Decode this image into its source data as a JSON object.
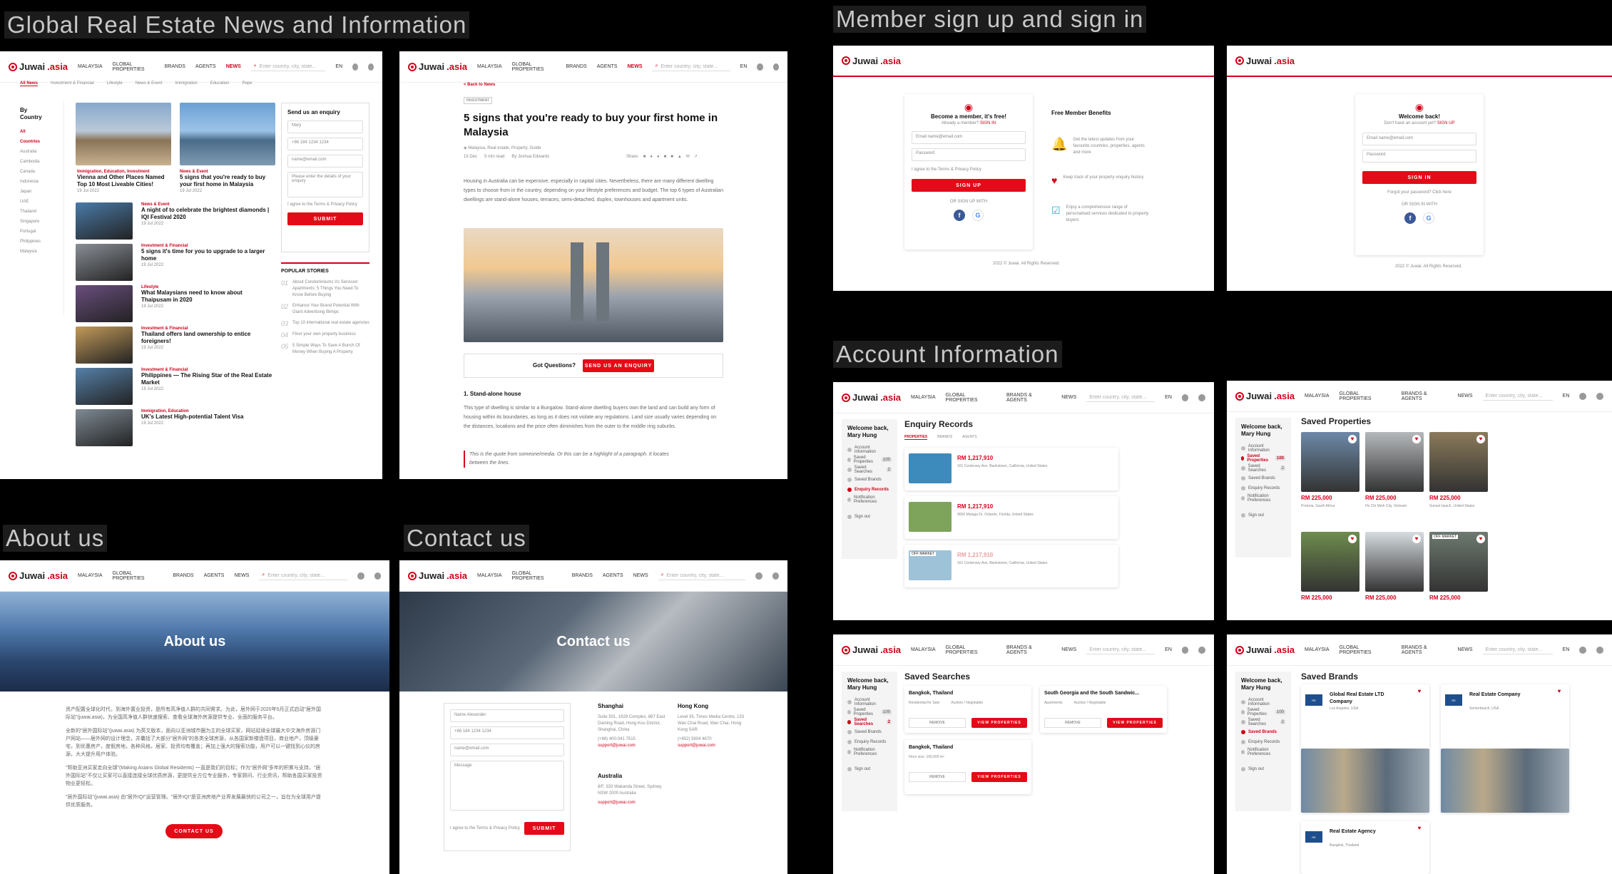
{
  "sections": {
    "news": "Global Real Estate News and Information",
    "member": "Member sign up and sign in",
    "account": "Account Information",
    "about": "About us",
    "contact": "Contact us"
  },
  "colors": {
    "brand": "#e30b17",
    "bg": "#000000"
  },
  "nav": {
    "logo": "Juwai",
    "logo_suffix": ".asia",
    "country": "MALAYSIA",
    "global": "GLOBAL PROPERTIES",
    "brands": "BRANDS",
    "agents": "AGENTS",
    "news": "NEWS",
    "brands_agents": "BRANDS & AGENTS",
    "search_placeholder": "Enter country, city, state...",
    "lang": "EN"
  },
  "news_page": {
    "tabs": [
      "All News",
      "Investment & Financial",
      "Lifestyle",
      "News & Event",
      "Immigration",
      "Education",
      "Pepe"
    ],
    "by_country": "By Country",
    "countries": [
      "All Countries",
      "Australia",
      "Cambodia",
      "Canada",
      "Indonesia",
      "Japan",
      "UAE",
      "Thailand",
      "Singapore",
      "Portugal",
      "Philippines",
      "Malaysia"
    ],
    "featured": [
      {
        "cat": "Immigration, Education, Investment",
        "title": "Vienna and Other Places Named Top 10 Most Liveable Cities!",
        "date": "19 Jul 2022"
      },
      {
        "cat": "News & Event",
        "title": "5 signs that you're ready to buy your first home in Malaysia",
        "date": "19 Jul 2022"
      }
    ],
    "list": [
      {
        "cat": "News & Event",
        "title": "A night of to celebrate the brightest diamonds | IQI Festival 2020",
        "date": "19 Jul 2022"
      },
      {
        "cat": "Investment & Financial",
        "title": "5 signs it's time for you to upgrade to a larger home",
        "date": "19 Jul 2022"
      },
      {
        "cat": "Lifestyle",
        "title": "What Malaysians need to know about Thaipusam in 2020",
        "date": "19 Jul 2022"
      },
      {
        "cat": "Investment & Financial",
        "title": "Thailand offers land ownership to entice foreigners!",
        "date": "19 Jul 2022"
      },
      {
        "cat": "Investment & Financial",
        "title": "Philippines — The Rising Star of the Real Estate Market",
        "date": "19 Jul 2022"
      },
      {
        "cat": "Immigration, Education",
        "title": "UK's Latest High-potential Talent Visa",
        "date": "19 Jul 2022"
      }
    ],
    "enquiry_title": "Send us an enquiry",
    "enquiry_name": "Mary",
    "enquiry_phone": "+86 184 1234 1234",
    "enquiry_email": "name@email.com",
    "enquiry_msg": "Please enter the details of your enquiry",
    "agree": "I agree to the Terms & Privacy Policy",
    "submit": "SUBMIT",
    "popular": "POPULAR STORIES",
    "stories": [
      {
        "n": "01",
        "t": "About Condominiums Vs Serviced Apartments: 5 Things You Need To Know Before Buying"
      },
      {
        "n": "02",
        "t": "Enhance Your Brand Potential With Giant Advertising Blimps"
      },
      {
        "n": "03",
        "t": "Top 10 international real estate agencies"
      },
      {
        "n": "04",
        "t": "Floor your own property business"
      },
      {
        "n": "05",
        "t": "5 Simple Ways To Save A Bunch Of Money When Buying A Property"
      }
    ]
  },
  "article": {
    "back": "< Back to News",
    "tag": "INVESTMENT",
    "title": "5 signs that you're ready to buy your first home in Malaysia",
    "meta": "Malaysia, Real estate, Property, Guide",
    "date": "15 Dec",
    "read": "5 min read",
    "author": "By Joshua Edwards",
    "share": "Share:",
    "body": "Housing in Australia can be expensive, especially in capital cities. Nevertheless, there are many different dwelling types to choose from in the country, depending on your lifestyle preferences and budget. The top 6 types of Australian dwellings are stand-alone houses, terraces, semi-detached, duplex, townhouses and apartment units.",
    "question": "Got Questions?",
    "enquiry_btn": "SEND US AN ENQUIRY",
    "h2": "1. Stand-alone house",
    "body2": "This type of dwelling is similar to a Bungalow. Stand-alone dwelling buyers own the land and can build any form of housing within its boundaries, as long as it does not violate any regulations. Land size usually varies depending on the distances, locations and the price often diminishes from the outer to the middle ring suburbs.",
    "quote": "This is the quote from someone/media. Or this can be a highlight of a paragraph.  It locates between the lines."
  },
  "signup": {
    "title": "Become a member, it's free!",
    "already": "Already a member?",
    "signin_link": "SIGN IN",
    "email_label": "Email",
    "email": "name@email.com",
    "password": "Password",
    "agree": "I agree to the Terms & Privacy Policy",
    "btn": "SIGN UP",
    "or": "OR SIGN UP WITH",
    "benefits_title": "Free Member Benefits",
    "benefits": [
      "Get the latest updates from your favourite countries, properties, agents and more",
      "Keep track of your property enquiry history",
      "Enjoy a comprehensive range of personalised services dedicated to property buyers"
    ],
    "copyright": "2022 © Juwai. All Rights Reserved."
  },
  "signin": {
    "title": "Welcome back!",
    "no_account": "Don't have an account yet?",
    "signup_link": "SIGN UP",
    "btn": "SIGN IN",
    "forgot": "Forgot your password? Click here",
    "or": "OR SIGN IN WITH"
  },
  "account": {
    "welcome": "Welcome back,",
    "user": "Mary Hung",
    "menu": [
      "Account Information",
      "Saved Properties",
      "Saved Searches",
      "Saved Brands",
      "Enquiry Records",
      "Notification Preferences",
      "Sign out"
    ],
    "saved_props_count": "100",
    "saved_searches_count": "2",
    "enquiry_title": "Enquiry Records",
    "enquiry_tabs": [
      "PROPERTIES",
      "BRANDS",
      "AGENTS"
    ],
    "enquiries": [
      {
        "price": "RM 1,217,910",
        "addr": "161 Centenary Ave, Bankstown, California, United States"
      },
      {
        "price": "RM 1,217,910",
        "addr": "9656 Malaga Dr, Orlando, Florida, United States"
      },
      {
        "price": "RM 1,217,910",
        "addr": "161 Centenary Ave, Bankstown, California, United States",
        "tag": "OFF MARKET"
      }
    ],
    "saved_title": "Saved Properties",
    "saved": [
      {
        "price": "RM 225,000",
        "loc": "Pretoria, South Africa"
      },
      {
        "price": "RM 225,000",
        "loc": "Ho Chi Minh City, Vietnam"
      },
      {
        "price": "RM 225,000",
        "loc": "Sunset beach, United States"
      },
      {
        "price": "RM 225,000",
        "loc": ""
      },
      {
        "price": "RM 225,000",
        "loc": ""
      },
      {
        "price": "RM 225,000",
        "loc": "",
        "tag": "OFF MARKET"
      }
    ],
    "searches_title": "Saved Searches",
    "searches": [
      {
        "t": "Bangkok, Thailand",
        "a": "Residential for Sale",
        "b": "Auction / Negotiable"
      },
      {
        "t": "South Georgia and the South Sandwic...",
        "a": "Apartments",
        "b": "Auction / Negotiable"
      },
      {
        "t": "Bangkok, Thailand",
        "a": "Floor size: 100,000 m²",
        "b": ""
      }
    ],
    "remove": "REMOVE",
    "view": "VIEW PROPERTIES",
    "brands_title": "Saved Brands",
    "brands": [
      {
        "name": "Global Real Estate LTD Company",
        "loc": "Los Angeles, USA"
      },
      {
        "name": "Real Estate Company",
        "loc": "Somerbeach, USA"
      },
      {
        "name": "Real Estate Agency",
        "loc": "Bangkok, Thailand"
      }
    ]
  },
  "about": {
    "hero": "About us",
    "p1": "资产配置全球化时代，到海外置业投资，是所有高净值人群的共同需求。为此，居外网于2020年5月正式启动\"居外国际站\"(juwai.asia)，为全国高净值人群快速搜索、查看全球海外房源提供专业、全面的服务平台。",
    "p2": "全新的\"居外国际站\"(juwai.asia) 为英文版本，面向以亚洲城市圈为主的全球买家，网站延续全球最大中文海外房源门户网站——居外网的设计理念，并囊括了大部分\"居外网\"的各类全球房源，从各国家新楼盘项目，商业地产，顶级豪宅，到优惠房产，度假房地，各种风格，居家、投资均有覆盖；再加上强大的搜索功能，用户可以一键找到心仪的房源，大大提升用户体验。",
    "p3": "\"帮助亚洲买家走向全球\"(Making Asians Global Residents) 一直是我们的目标；作为\"居外网\"多年的积累与支持，\"居外国际站\"不仅让买家可以直接连接全球优质房源，更提供全方位专业服务，专家顾问、行业资讯，帮助各国买家投资物业更轻松。",
    "p4": "\"居外国际站\"(juwai.asia) 由\"居外IQI\"运营管理。\"居外IQI\"是亚洲房地产业界发展最快的公司之一，旨在为全球用户提供优质服务。",
    "btn": "CONTACT US"
  },
  "contact": {
    "hero": "Contact us",
    "name_label": "Name",
    "name": "Alexander",
    "phone": "+86 184 1234 1234",
    "email": "name@email.com",
    "message": "Message",
    "agree": "I agree to the Terms & Privacy Policy",
    "submit": "SUBMIT",
    "offices": [
      {
        "city": "Shanghai",
        "addr": "Suite 501, 1929 Complex, 887 East Daming Road, Hong Kou District, Shanghai, China",
        "tel": "(+86) 400-041 7515",
        "mail": "support@juwai.com"
      },
      {
        "city": "Hong Kong",
        "addr": "Level 35, Times Media Centre, 133 Wan Chai Road, Wan Chai, Hong Kong SAR",
        "tel": "(+852) 5804 4670",
        "mail": "support@juwai.com"
      },
      {
        "city": "Australia",
        "addr": "8/F, 333 Wakanda Street, Sydney, NSW 2000 Australia",
        "tel": "",
        "mail": "support@juwai.com"
      }
    ]
  }
}
